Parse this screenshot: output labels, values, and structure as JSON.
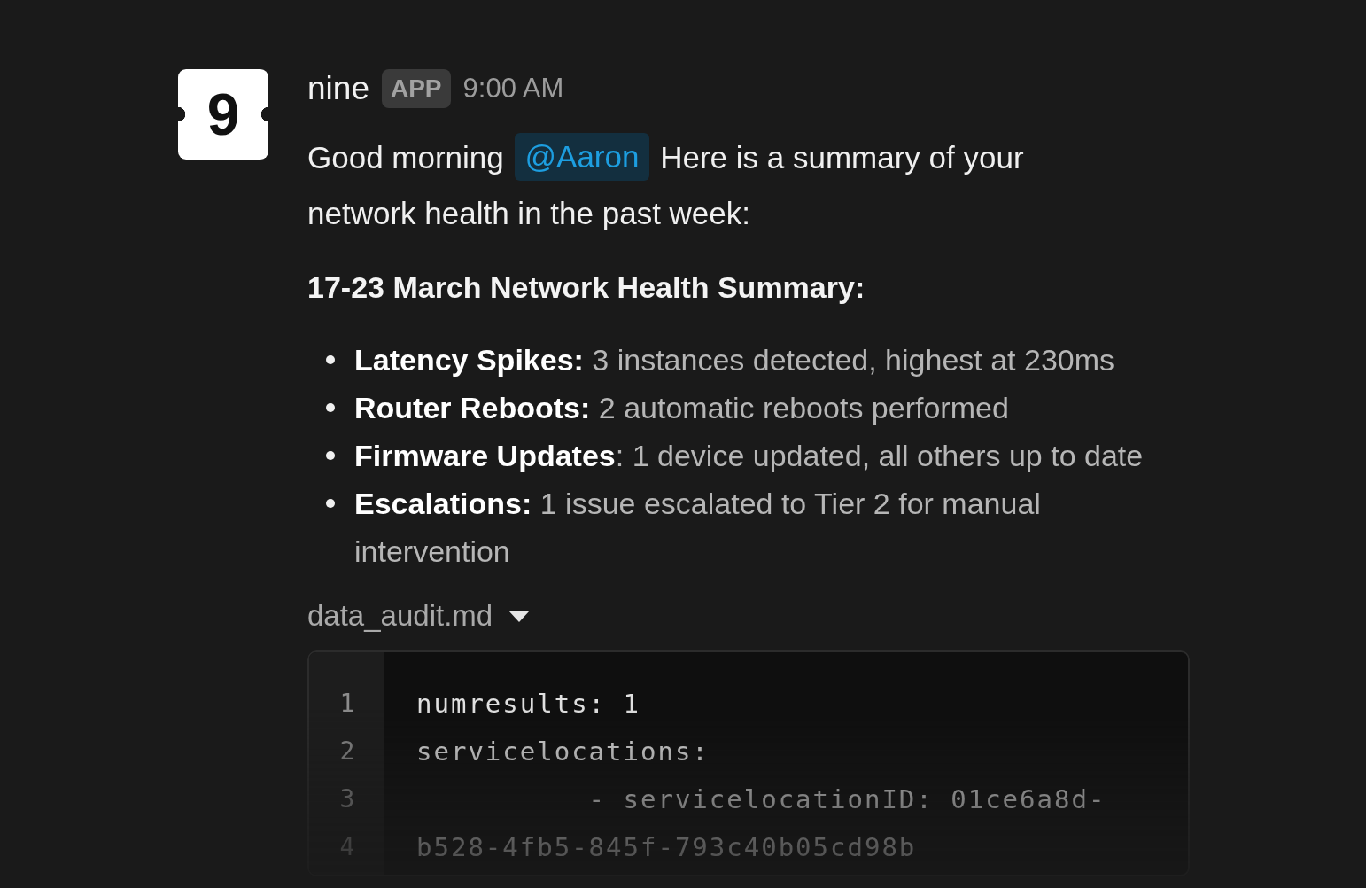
{
  "message": {
    "avatar": {
      "label": "9"
    },
    "sender": "nine",
    "badge": "APP",
    "time": "9:00 AM",
    "greeting": {
      "before": "Good morning",
      "mention": "@Aaron",
      "after": "Here is a summary of your network health in the past week:"
    },
    "heading": "17-23 March Network Health Summary:",
    "bullets": [
      "**Latency Spikes:** 3 instances detected, highest at 230ms",
      "**Router Reboots:** 2 automatic reboots performed",
      "**Firmware Updates**: 1 device updated, all others up to date",
      "**Escalations:** 1 issue escalated to Tier 2 for manual intervention"
    ],
    "attachment": {
      "filename": "data_audit.md",
      "expanded": true,
      "lines": [
        {
          "number": "1",
          "code": "numresults: 1"
        },
        {
          "number": "2",
          "code": "servicelocations:"
        },
        {
          "number": "3",
          "code": "          - servicelocationID: 01ce6a8d-"
        },
        {
          "number": "4",
          "code": "b528-4fb5-845f-793c40b05cd98b"
        }
      ]
    }
  }
}
